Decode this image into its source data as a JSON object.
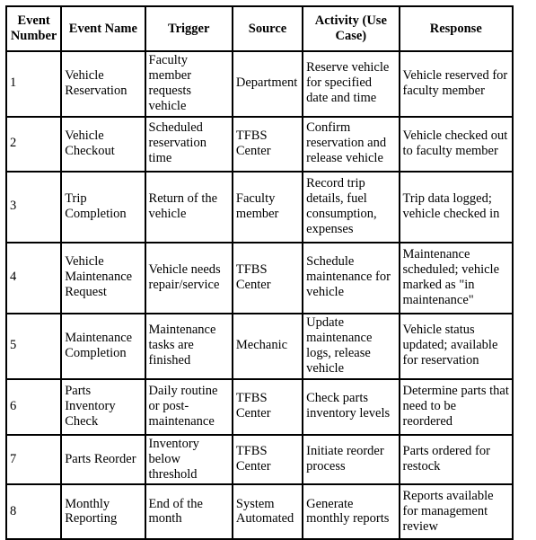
{
  "table": {
    "name": "event-table",
    "columns": [
      {
        "key": "number",
        "label": "Event Number"
      },
      {
        "key": "name",
        "label": "Event Name"
      },
      {
        "key": "trigger",
        "label": "Trigger"
      },
      {
        "key": "source",
        "label": "Source"
      },
      {
        "key": "activity",
        "label": "Activity (Use Case)"
      },
      {
        "key": "response",
        "label": "Response"
      }
    ],
    "rows": [
      {
        "number": "1",
        "name": "Vehicle Reservation",
        "trigger": "Faculty member requests vehicle",
        "source": "Department",
        "activity": "Reserve vehicle for specified date and time",
        "response": "Vehicle reserved for faculty member"
      },
      {
        "number": "2",
        "name": "Vehicle Checkout",
        "trigger": "Scheduled reservation time",
        "source": "TFBS Center",
        "activity": "Confirm reservation and release vehicle",
        "response": "Vehicle checked out to faculty member"
      },
      {
        "number": "3",
        "name": "Trip Completion",
        "trigger": "Return of the vehicle",
        "source": "Faculty member",
        "activity": "Record trip details, fuel consumption, expenses",
        "response": "Trip data logged; vehicle checked in"
      },
      {
        "number": "4",
        "name": "Vehicle Maintenance Request",
        "trigger": "Vehicle needs repair/service",
        "source": "TFBS Center",
        "activity": "Schedule maintenance for vehicle",
        "response": "Maintenance scheduled; vehicle marked as \"in maintenance\""
      },
      {
        "number": "5",
        "name": "Maintenance Completion",
        "trigger": "Maintenance tasks are finished",
        "source": "Mechanic",
        "activity": "Update maintenance logs, release vehicle",
        "response": "Vehicle status updated; available for reservation"
      },
      {
        "number": "6",
        "name": "Parts Inventory Check",
        "trigger": "Daily routine or post-maintenance",
        "source": "TFBS Center",
        "activity": "Check parts inventory levels",
        "response": "Determine parts that need to be reordered"
      },
      {
        "number": "7",
        "name": "Parts Reorder",
        "trigger": "Inventory below threshold",
        "source": "TFBS Center",
        "activity": "Initiate reorder process",
        "response": "Parts ordered for restock"
      },
      {
        "number": "8",
        "name": "Monthly Reporting",
        "trigger": "End of the month",
        "source": "System Automated",
        "activity": "Generate monthly reports",
        "response": "Reports available for management review"
      }
    ]
  }
}
